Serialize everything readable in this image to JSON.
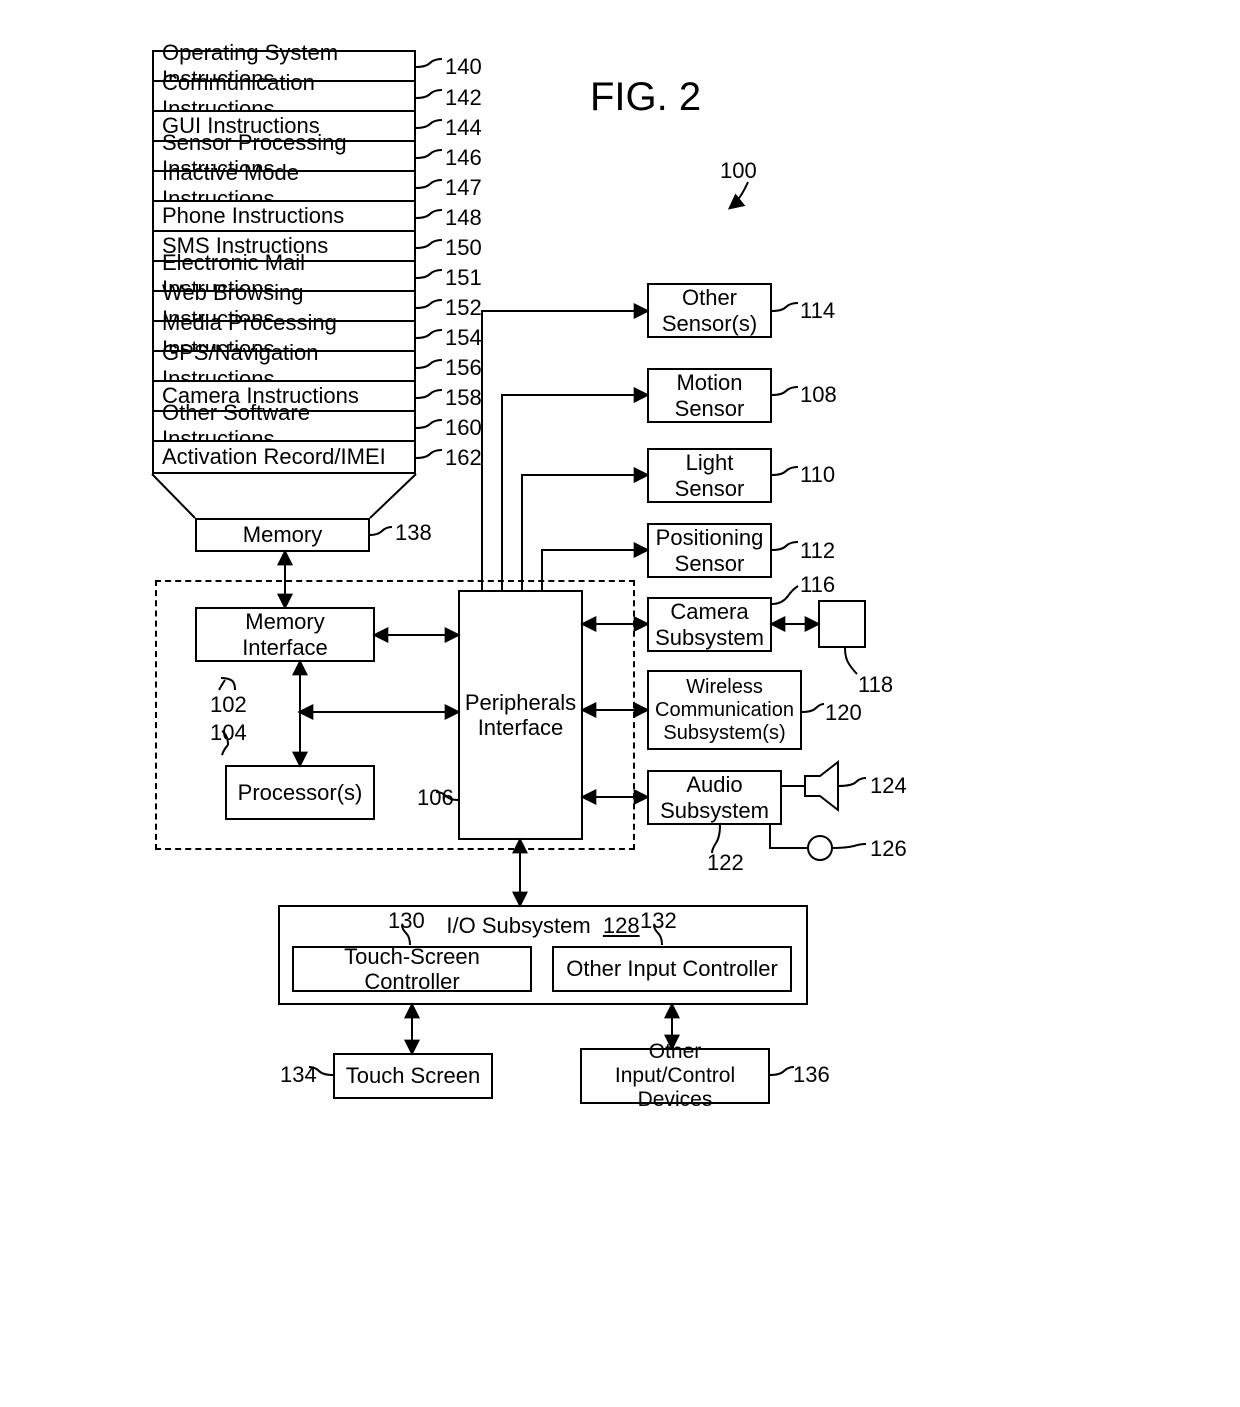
{
  "figure": {
    "label": "FIG. 2",
    "overall_ref": "100"
  },
  "instructions": [
    {
      "label": "Operating System Instructions",
      "ref": "140"
    },
    {
      "label": "Communication Instructions",
      "ref": "142"
    },
    {
      "label": "GUI Instructions",
      "ref": "144"
    },
    {
      "label": "Sensor Processing Instructions",
      "ref": "146"
    },
    {
      "label": "Inactive Mode Instructions",
      "ref": "147"
    },
    {
      "label": "Phone Instructions",
      "ref": "148"
    },
    {
      "label": "SMS Instructions",
      "ref": "150"
    },
    {
      "label": "Electronic Mail Instructions",
      "ref": "151"
    },
    {
      "label": "Web Browsing Instructions",
      "ref": "152"
    },
    {
      "label": "Media Processing Instructions",
      "ref": "154"
    },
    {
      "label": "GPS/Navigation Instructions",
      "ref": "156"
    },
    {
      "label": "Camera Instructions",
      "ref": "158"
    },
    {
      "label": "Other Software Instructions",
      "ref": "160"
    },
    {
      "label": "Activation Record/IMEI",
      "ref": "162"
    }
  ],
  "memory": {
    "label": "Memory",
    "ref": "138"
  },
  "memory_if": {
    "label": "Memory Interface",
    "ref": "102"
  },
  "processors": {
    "label": "Processor(s)",
    "ref": "104"
  },
  "periph_if": {
    "label": "Peripherals Interface",
    "ref": "106"
  },
  "sensors": {
    "other": {
      "label": "Other Sensor(s)",
      "ref": "114"
    },
    "motion": {
      "label": "Motion Sensor",
      "ref": "108"
    },
    "light": {
      "label": "Light Sensor",
      "ref": "110"
    },
    "position": {
      "label": "Positioning Sensor",
      "ref": "112"
    }
  },
  "camera_sub": {
    "label": "Camera Subsystem",
    "ref": "116",
    "extra_ref": "118"
  },
  "wireless_sub": {
    "label": "Wireless Communication Subsystem(s)",
    "ref": "120"
  },
  "audio_sub": {
    "label": "Audio Subsystem",
    "ref": "122",
    "speaker_ref": "124",
    "mic_ref": "126"
  },
  "io_sub": {
    "label": "I/O Subsystem",
    "ref": "128",
    "touch_ctrl": {
      "label": "Touch-Screen Controller",
      "ref": "130"
    },
    "other_ctrl": {
      "label": "Other Input Controller",
      "ref": "132"
    }
  },
  "touch_screen": {
    "label": "Touch Screen",
    "ref": "134"
  },
  "other_input": {
    "label": "Other Input/Control Devices",
    "ref": "136"
  }
}
